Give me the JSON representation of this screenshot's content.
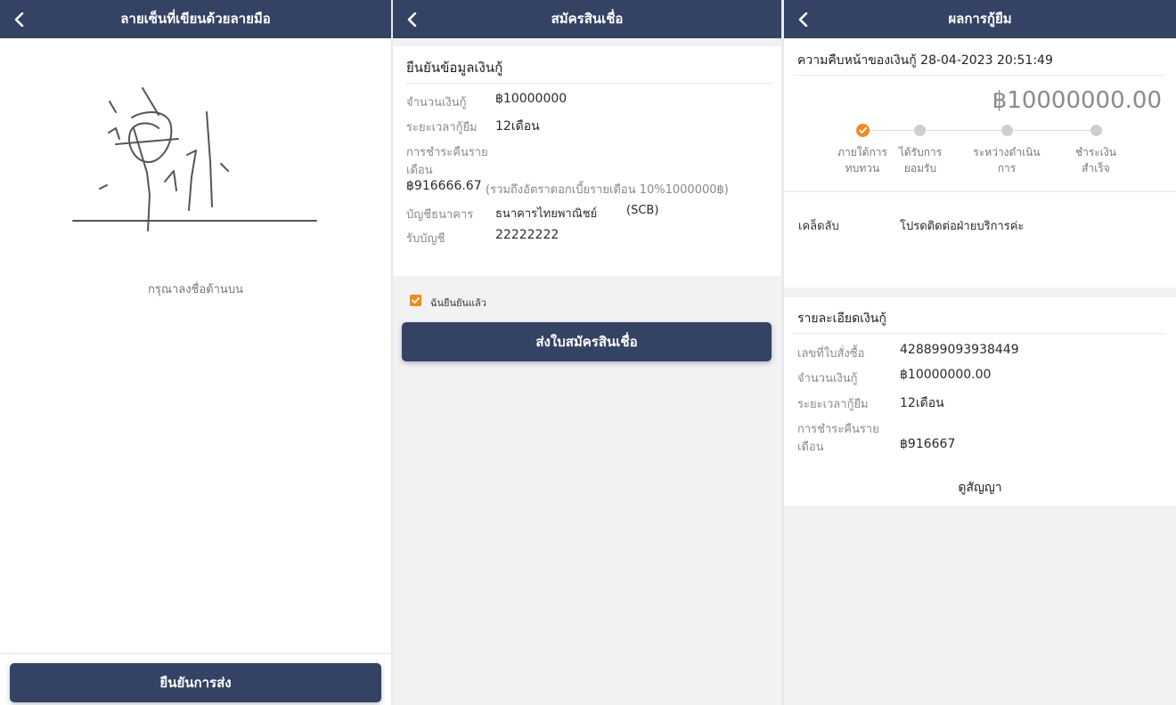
{
  "signature_screen": {
    "title": "ลายเซ็นที่เขียนด้วยลายมือ",
    "hint": "กรุณาลงชื่อด้านบน",
    "confirm_button": "ยืนยันการส่ง"
  },
  "apply_screen": {
    "title": "สมัครสินเชื่อ",
    "section_title": "ยืนยันข้อมูลเงินกู้",
    "amount_label": "จำนวนเงินกู้",
    "amount_value": "฿10000000",
    "term_label": "ระยะเวลากู้ยืม",
    "term_value": "12เดือน",
    "repay_label_1": "การชำระคืนราย",
    "repay_label_2": "เดือน",
    "repay_value": "฿916666.67",
    "repay_note": "(รวมถึงอัตราดอกเบี้ยรายเดือน 10%1000000฿)",
    "bank_label": "บัญชีธนาคาร",
    "bank_value": "ธนาคารไทยพาณิชย์",
    "bank_code": "(SCB)",
    "account_label": "รับบัญชี",
    "account_value": "22222222",
    "agree_label": "ฉันยืนยันแล้ว",
    "submit_button": "ส่งใบสมัครสินเชื่อ"
  },
  "result_screen": {
    "title": "ผลการกู้ยืม",
    "progress_title": "ความคืบหน้าของเงินกู้ 28-04-2023 20:51:49",
    "big_amount": "฿10000000.00",
    "steps": [
      {
        "line1": "ภายใต้การ",
        "line2": "ทบทวน",
        "active": true
      },
      {
        "line1": "ได้รับการ",
        "line2": "ยอมรับ",
        "active": false
      },
      {
        "line1": "ระหว่างดำเนิน",
        "line2": "การ",
        "active": false
      },
      {
        "line1": "ชำระเงิน",
        "line2": "สำเร็จ",
        "active": false
      }
    ],
    "tips_label": "เคล็ดลับ",
    "tips_value": "โปรดติดต่อฝ่ายบริการค่ะ",
    "details_title": "รายละเอียดเงินกู้",
    "order_label": "เลขที่ใบสั่งซื้อ",
    "order_value": "428899093938449",
    "amount_label": "จำนวนเงินกู้",
    "amount_value": "฿10000000.00",
    "term_label": "ระยะเวลากู้ยืม",
    "term_value": "12เดือน",
    "repay_label_1": "การชำระคืนราย",
    "repay_label_2": "เดือน",
    "repay_value": "฿916667",
    "contract_link": "ดูสัญญา"
  },
  "colors": {
    "header": "#344264",
    "accent": "#f08a24",
    "step_inactive": "#cfcfd3"
  },
  "icons": {
    "back": "chevron-left-icon",
    "check": "check-icon"
  }
}
